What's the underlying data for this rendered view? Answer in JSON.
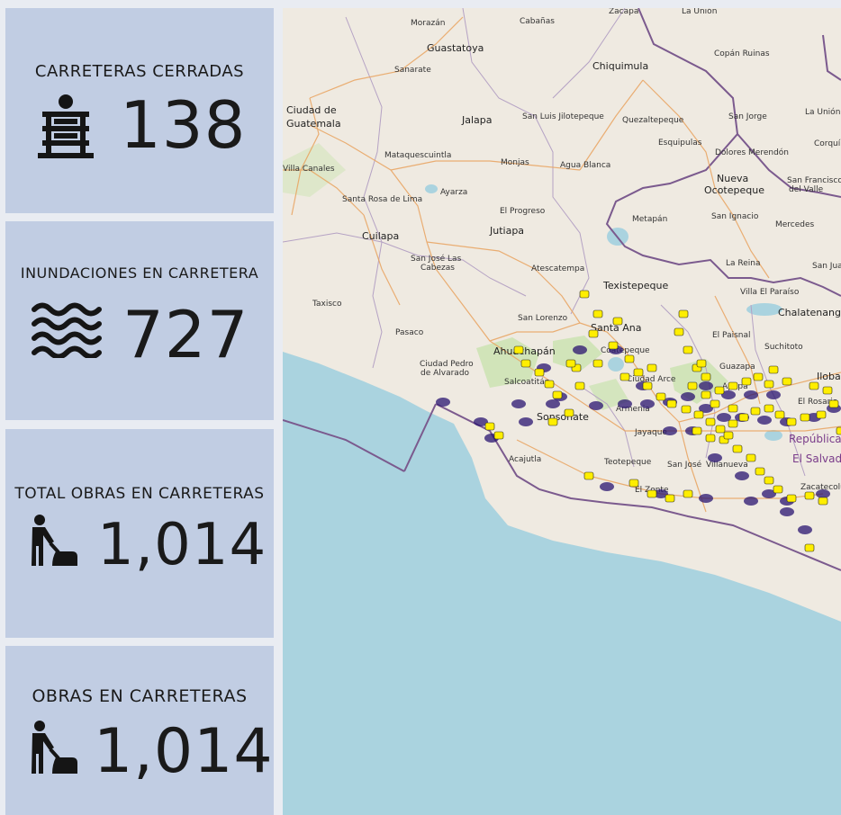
{
  "cards": [
    {
      "title": "CARRETERAS CERRADAS",
      "value": "138",
      "icon": "road-closed-icon"
    },
    {
      "title": "INUNDACIONES EN CARRETERA",
      "value": "727",
      "icon": "water-waves-icon"
    },
    {
      "title": "TOTAL OBRAS EN CARRETERAS",
      "value": "1,014",
      "icon": "road-worker-icon"
    },
    {
      "title": "OBRAS EN CARRETERAS",
      "value": "1,014",
      "icon": "road-worker-icon"
    }
  ],
  "map": {
    "place_labels": [
      "Zacapa",
      "La Unión",
      "Morazán",
      "Cabañas",
      "Guastatoya",
      "Sanarate",
      "Chiquimula",
      "Copán Ruinas",
      "Ciudad de",
      "Guatemala",
      "Jalapa",
      "San Luis Jilotepeque",
      "Quezaltepeque",
      "San Jorge",
      "La Unión",
      "Esquipulas",
      "Corquí",
      "Mataquescuintla",
      "Monjas",
      "Agua Blanca",
      "Dolores Merendón",
      "Villa Canales",
      "Nueva",
      "Ocotepeque",
      "San Francisco",
      "del Valle",
      "Ayarza",
      "Santa Rosa de Lima",
      "El Progreso",
      "Metapán",
      "San Ignacio",
      "Mercedes",
      "Cuilapa",
      "Jutiapa",
      "San José Las",
      "Cabezas",
      "Atescatempa",
      "La Reina",
      "San Juan",
      "Texistepeque",
      "Villa El Paraíso",
      "Taxisco",
      "San Lorenzo",
      "Chalatenango",
      "Santa Ana",
      "El Paisnal",
      "Suchitoto",
      "Pasaco",
      "Ahuachapán",
      "Coatepeque",
      "Guazapa",
      "Ilobasco",
      "Ciudad Pedro",
      "de Alvarado",
      "Salcoatitán",
      "Ciudad Arce",
      "Apopa",
      "El Rosario",
      "Sonsonate",
      "Armenia",
      "Jayaque",
      "República de",
      "El Salvador",
      "Acajutla",
      "Teotepeque",
      "San José",
      "Villanueva",
      "El Zonte",
      "Zacatecoluca"
    ]
  },
  "colors": {
    "card_bg": "#c1cde3",
    "water": "#aad3df",
    "incident_marker": "#ffee00",
    "flood_heat": "#2a1470",
    "border": "#7b5a8e"
  }
}
